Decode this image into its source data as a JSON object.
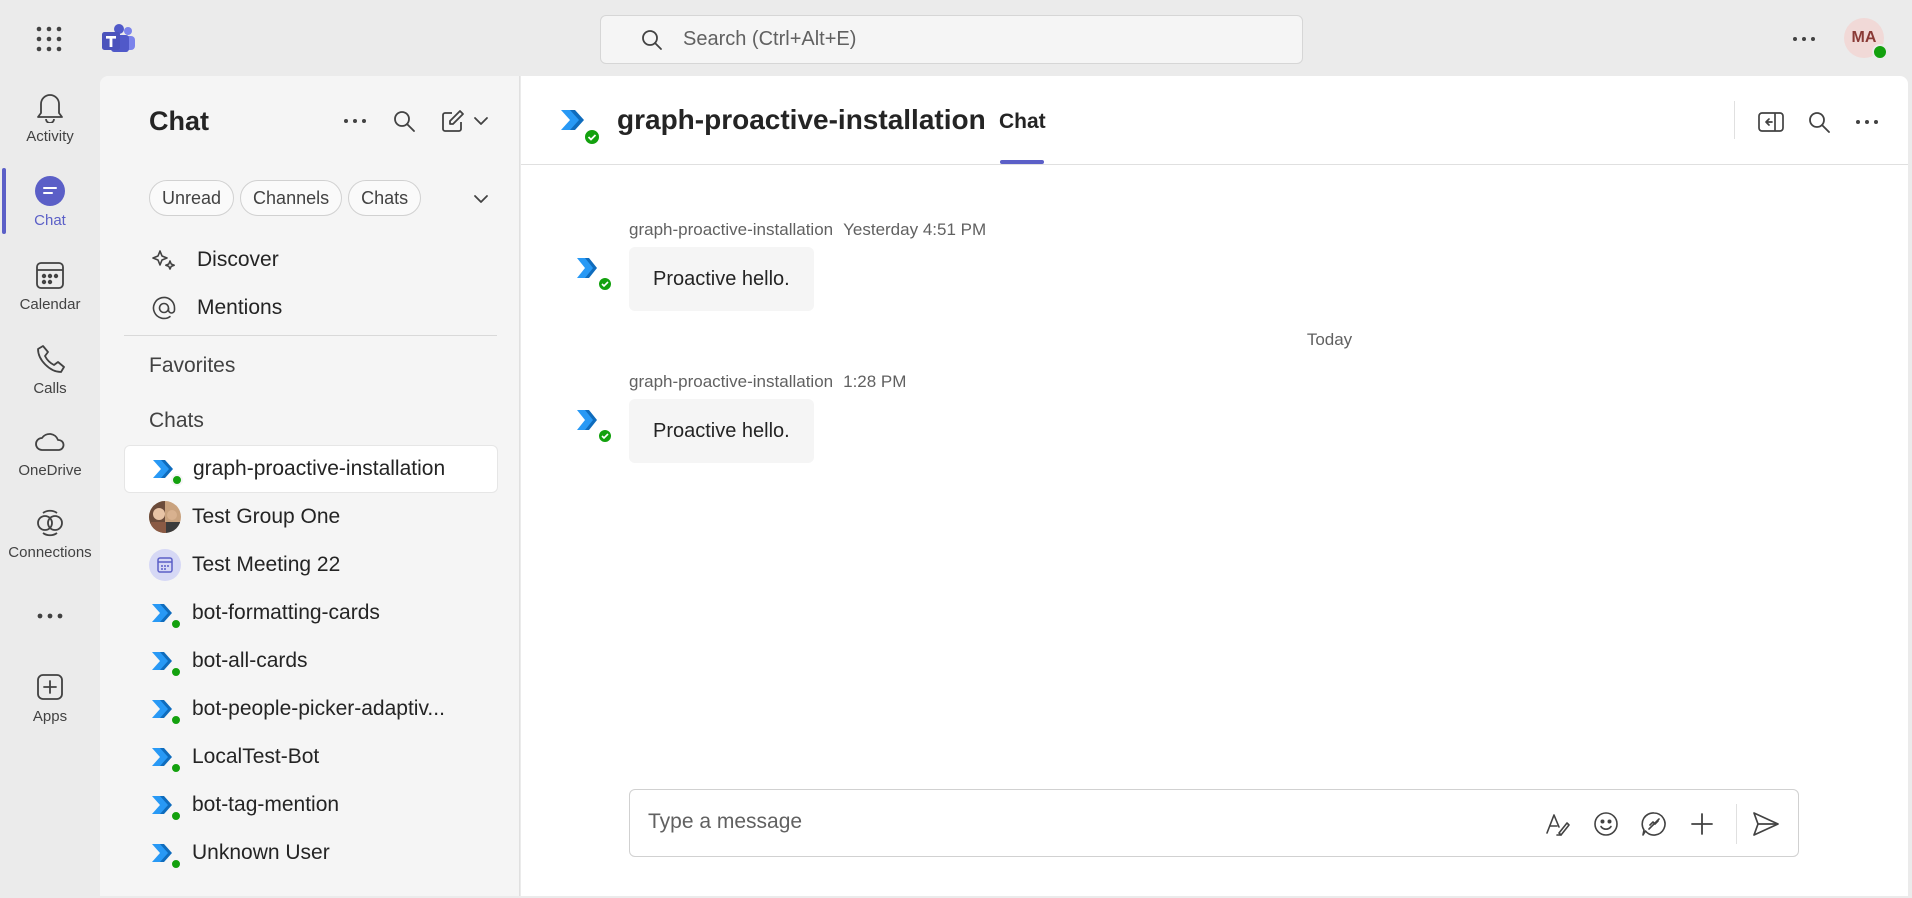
{
  "topbar": {
    "search_placeholder": "Search (Ctrl+Alt+E)",
    "avatar_initials": "MA"
  },
  "rail": {
    "items": [
      {
        "label": "Activity",
        "icon": "bell-icon"
      },
      {
        "label": "Chat",
        "icon": "chat-icon",
        "active": true
      },
      {
        "label": "Calendar",
        "icon": "calendar-icon"
      },
      {
        "label": "Calls",
        "icon": "phone-icon"
      },
      {
        "label": "OneDrive",
        "icon": "cloud-icon"
      },
      {
        "label": "Connections",
        "icon": "connections-icon"
      },
      {
        "label": "",
        "icon": "more-icon"
      },
      {
        "label": "Apps",
        "icon": "add-app-icon"
      }
    ]
  },
  "chatlist": {
    "title": "Chat",
    "filters": [
      "Unread",
      "Channels",
      "Chats"
    ],
    "nav": [
      {
        "label": "Discover",
        "icon": "sparkle-icon"
      },
      {
        "label": "Mentions",
        "icon": "at-icon"
      }
    ],
    "favorites_label": "Favorites",
    "chats_label": "Chats",
    "chats": [
      {
        "name": "graph-proactive-installation",
        "type": "bot",
        "selected": true
      },
      {
        "name": "Test Group One",
        "type": "group"
      },
      {
        "name": "Test Meeting 22",
        "type": "meeting"
      },
      {
        "name": "bot-formatting-cards",
        "type": "bot"
      },
      {
        "name": "bot-all-cards",
        "type": "bot"
      },
      {
        "name": "bot-people-picker-adaptiv...",
        "type": "bot"
      },
      {
        "name": "LocalTest-Bot",
        "type": "bot"
      },
      {
        "name": "bot-tag-mention",
        "type": "bot"
      },
      {
        "name": "Unknown User",
        "type": "bot"
      }
    ]
  },
  "conversation": {
    "title": "graph-proactive-installation",
    "tab": "Chat",
    "messages": [
      {
        "sender": "graph-proactive-installation",
        "time": "Yesterday 4:51 PM",
        "text": "Proactive hello."
      },
      {
        "sender": "graph-proactive-installation",
        "time": "1:28 PM",
        "text": "Proactive hello."
      }
    ],
    "date_separator": "Today",
    "composer_placeholder": "Type a message"
  },
  "colors": {
    "accent": "#5b5fc7",
    "presence": "#13a10e",
    "bot_blue": "#0f6cbd",
    "bot_light": "#2899f5"
  }
}
